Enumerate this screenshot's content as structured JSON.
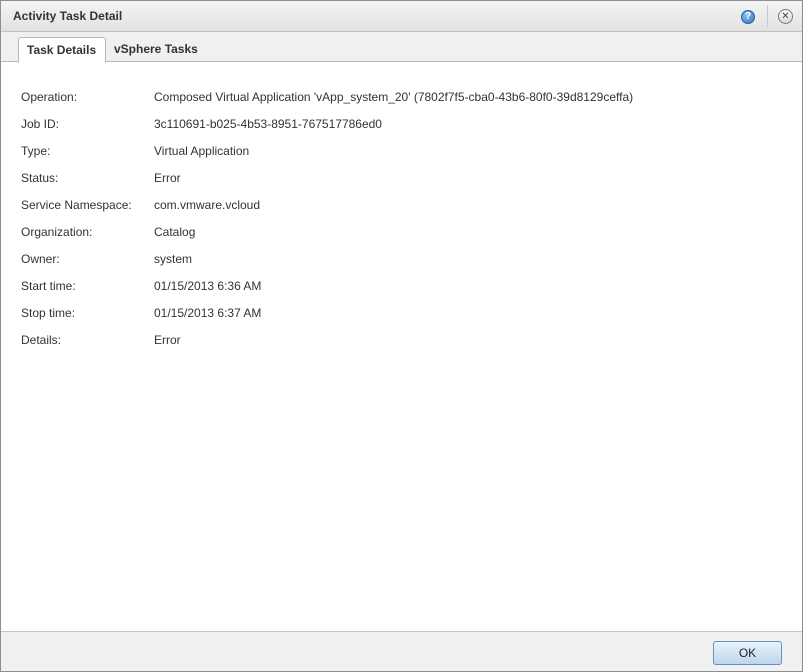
{
  "dialog": {
    "title": "Activity Task Detail",
    "help_glyph": "?",
    "close_glyph": "✕"
  },
  "tabs": [
    {
      "label": "Task Details",
      "active": true
    },
    {
      "label": "vSphere Tasks",
      "active": false
    }
  ],
  "details": [
    {
      "label": "Operation:",
      "value": "Composed Virtual Application 'vApp_system_20' (7802f7f5-cba0-43b6-80f0-39d8129ceffa)"
    },
    {
      "label": "Job ID:",
      "value": "3c110691-b025-4b53-8951-767517786ed0"
    },
    {
      "label": "Type:",
      "value": "Virtual Application"
    },
    {
      "label": "Status:",
      "value": "Error"
    },
    {
      "label": "Service Namespace:",
      "value": "com.vmware.vcloud"
    },
    {
      "label": "Organization:",
      "value": "Catalog"
    },
    {
      "label": "Owner:",
      "value": "system"
    },
    {
      "label": "Start time:",
      "value": "01/15/2013 6:36 AM"
    },
    {
      "label": "Stop time:",
      "value": "01/15/2013 6:37 AM"
    },
    {
      "label": "Details:",
      "value": "Error"
    }
  ],
  "footer": {
    "ok_label": "OK"
  },
  "icons": {
    "help": "help-icon",
    "close": "close-icon"
  },
  "colors": {
    "accent": "#2f6fc0",
    "ok_button": "#bcd6ee"
  }
}
